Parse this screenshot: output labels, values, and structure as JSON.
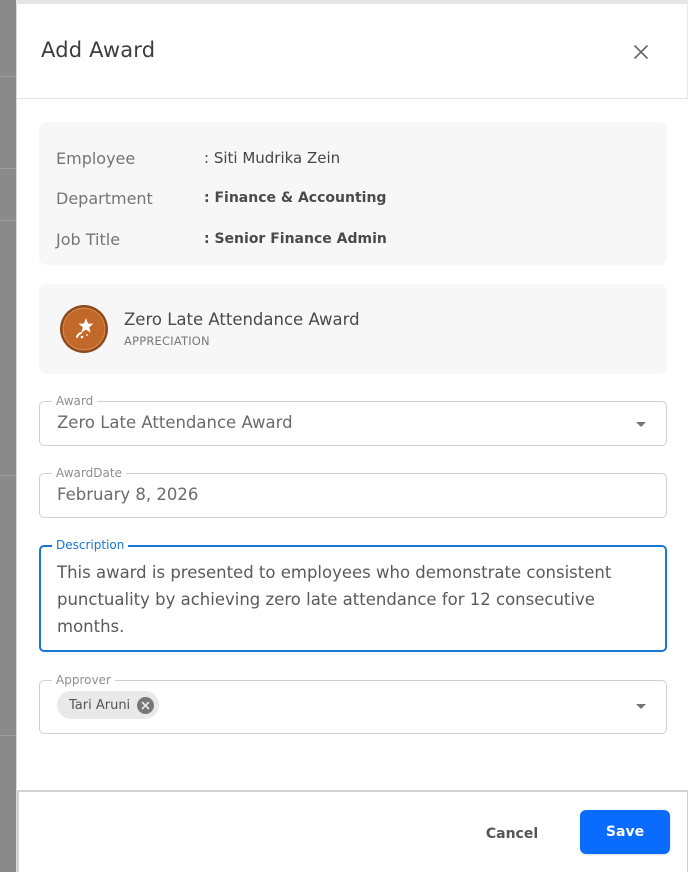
{
  "dialog": {
    "title": "Add Award",
    "close_icon": "close-icon"
  },
  "employee_info": {
    "rows": [
      {
        "label": "Employee",
        "value": ": Siti Mudrika Zein"
      },
      {
        "label": "Department",
        "value": ": Finance & Accounting"
      },
      {
        "label": "Job Title",
        "value": ": Senior Finance Admin"
      }
    ]
  },
  "award_card": {
    "badge_icon": "star-medal-icon",
    "name": "Zero Late Attendance Award",
    "type": "APPRECIATION"
  },
  "form": {
    "award": {
      "label": "Award",
      "value": "Zero Late Attendance Award"
    },
    "award_date": {
      "label": "AwardDate",
      "value": "February 8, 2026"
    },
    "description": {
      "label": "Description",
      "value": "This award is presented to employees who demonstrate consistent punctuality by achieving zero late attendance for 12 consecutive months."
    },
    "approver": {
      "label": "Approver",
      "chips": [
        {
          "label": "Tari Aruni"
        }
      ]
    }
  },
  "footer": {
    "cancel_label": "Cancel",
    "save_label": "Save"
  },
  "colors": {
    "primary": "#0a6cff",
    "focus": "#1976d2",
    "badge": "#c2692a"
  }
}
